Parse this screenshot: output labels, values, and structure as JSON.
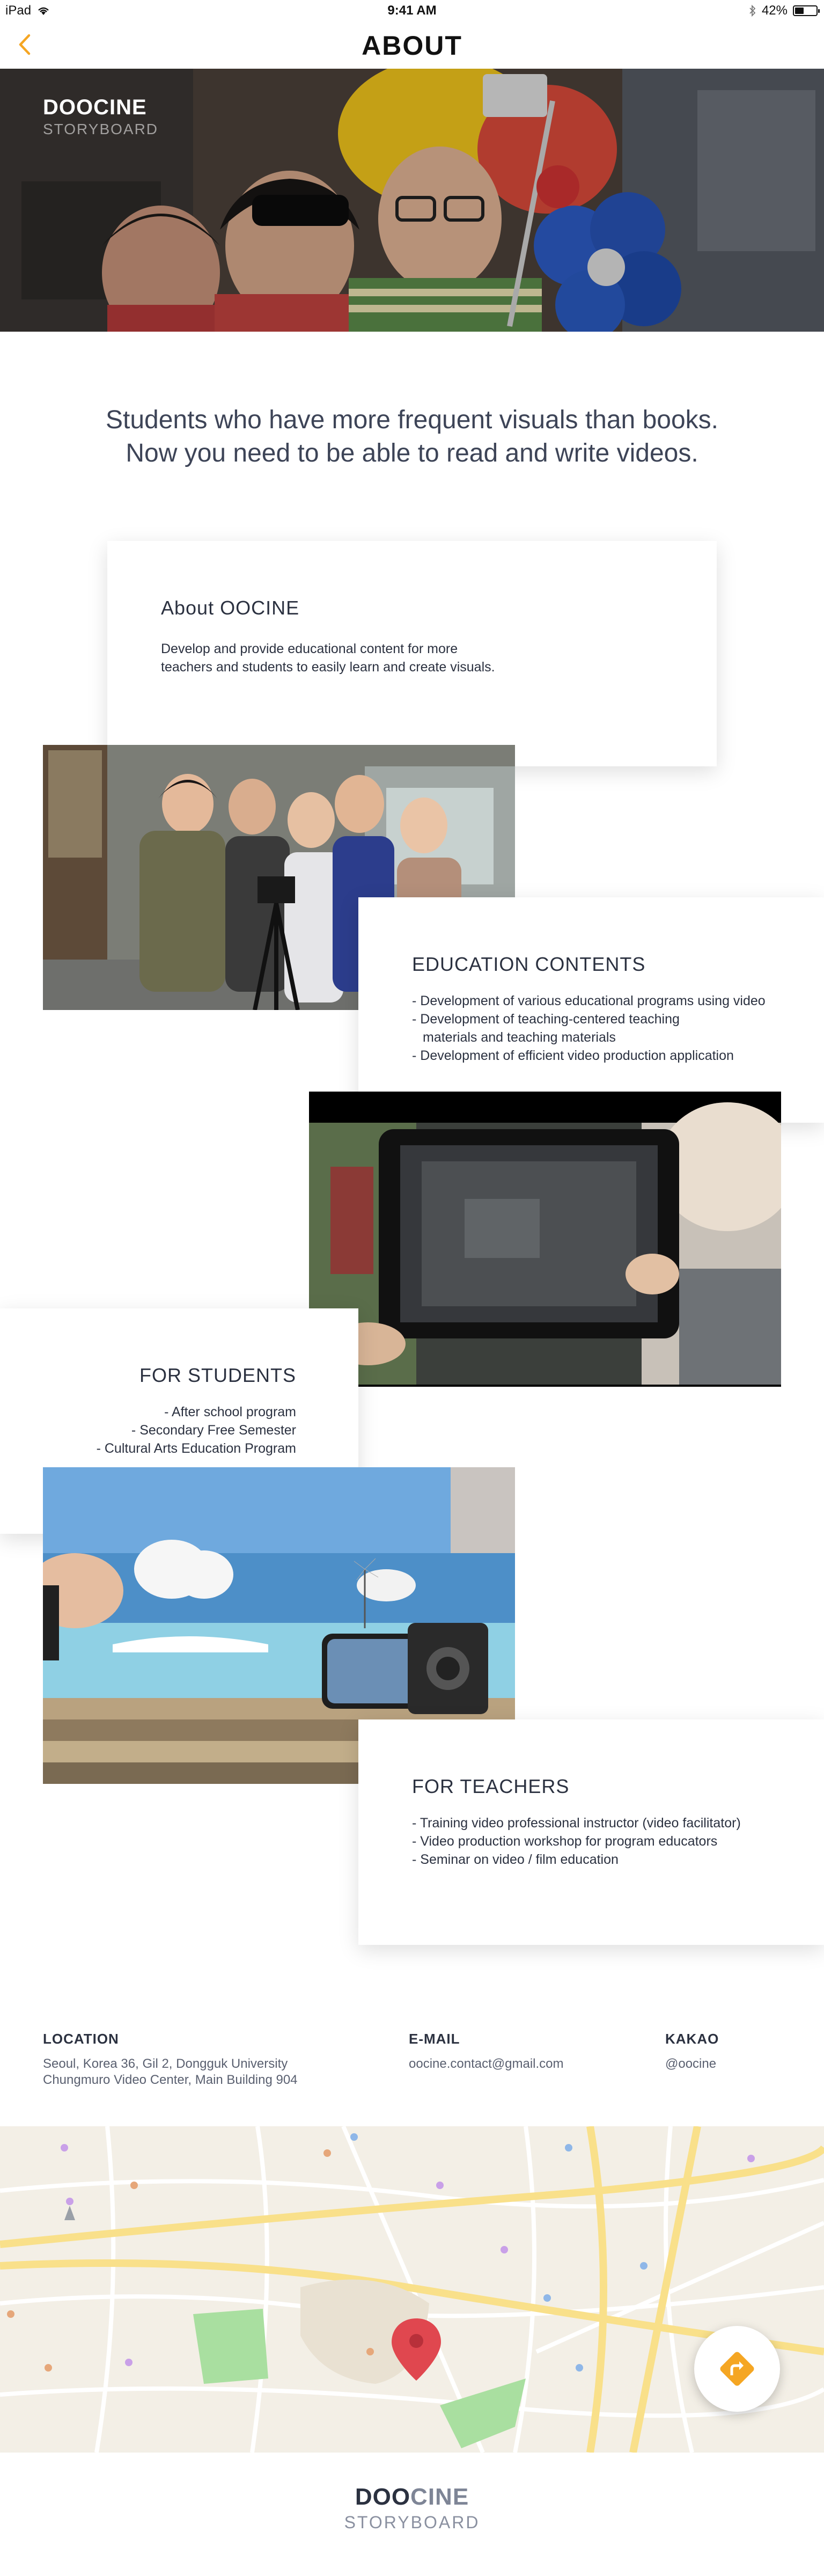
{
  "status_bar": {
    "device": "iPad",
    "time": "9:41 AM",
    "battery": "42%",
    "battery_level": 0.42
  },
  "nav": {
    "title": "ABOUT"
  },
  "hero": {
    "brand": "DOOCINE",
    "subtitle": "STORYBOARD"
  },
  "headline": {
    "line1": "Students who have more frequent visuals than books.",
    "line2": "Now you need to be able to read and write videos."
  },
  "about": {
    "title": "About OOCINE",
    "line1": "Develop and provide educational content for more",
    "line2": "teachers and students to easily learn and create visuals."
  },
  "education": {
    "title": "EDUCATION CONTENTS",
    "items": [
      "- Development of various educational programs using video",
      "- Development of teaching-centered teaching",
      "materials and teaching materials",
      "- Development of efficient video production application"
    ]
  },
  "students": {
    "title": "FOR STUDENTS",
    "items": [
      "- After school program",
      "- Secondary Free Semester",
      "- Cultural Arts Education Program"
    ]
  },
  "teachers": {
    "title": "FOR TEACHERS",
    "items": [
      "- Training video professional instructor (video facilitator)",
      "- Video production workshop for program educators",
      "- Seminar on video / film education"
    ]
  },
  "contact": {
    "location_label": "LOCATION",
    "location_line1": "Seoul, Korea 36, Gil 2, Dongguk University",
    "location_line2": "Chungmuro Video Center, Main Building 904",
    "email_label": "E-MAIL",
    "email": "oocine.contact@gmail.com",
    "kakao_label": "KAKAO",
    "kakao": "@oocine"
  },
  "footer": {
    "brand_doo": "DOO",
    "brand_cine": "CINE",
    "subtitle": "STORYBOARD"
  },
  "colors": {
    "accent": "#f5a623",
    "pin": "#e0474f",
    "text": "#2b3140",
    "map_bg": "#f3efe6",
    "park": "#a9dfa0"
  },
  "icons": {
    "back": "chevron-left-icon",
    "wifi": "wifi-icon",
    "bluetooth": "bluetooth-icon",
    "battery": "battery-icon",
    "pin": "map-pin-icon",
    "directions": "directions-icon"
  }
}
